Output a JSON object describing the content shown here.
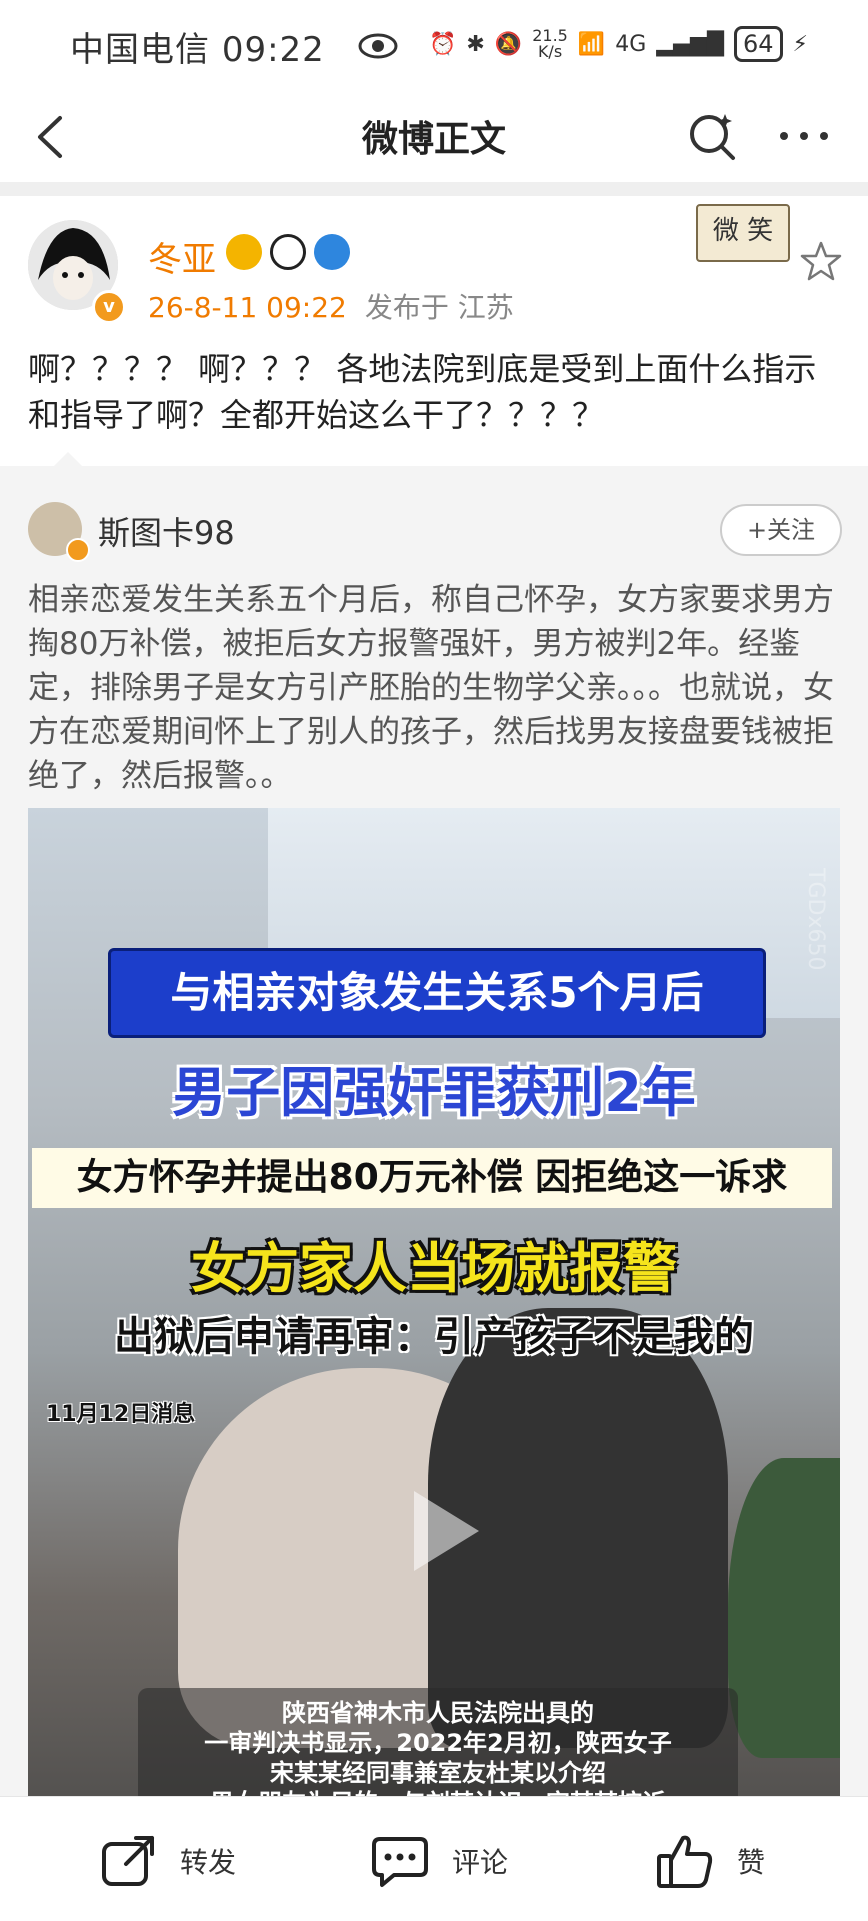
{
  "status_bar": {
    "carrier": "中国电信",
    "time": "09:22",
    "net_speed_value": "21.5",
    "net_speed_unit": "K/s",
    "network": "4G",
    "battery": "64"
  },
  "nav": {
    "title": "微博正文"
  },
  "post": {
    "username": "冬亚",
    "datetime": "26-8-11 09:22",
    "location": "发布于 江苏",
    "sticker_text": "微 笑",
    "text": "啊？？？？ 啊？？？ 各地法院到底是受到上面什么指示和指导了啊？全都开始这么干了？？？？"
  },
  "repost": {
    "username": "斯图卡98",
    "follow_label": "+关注",
    "text": "相亲恋爱发生关系五个月后，称自己怀孕，女方家要求男方掏80万补偿，被拒后女方报警强奸，男方被判2年。经鉴定，排除男子是女方引产胚胎的生物学父亲。。。也就说，女方在恋爱期间怀上了别人的孩子，然后找男友接盘要钱被拒绝了，然后报警。。",
    "video": {
      "banner1": "与相亲对象发生关系5个月后",
      "banner2": "男子因强奸罪获刑2年",
      "banner3": "女方怀孕并提出80万元补偿 因拒绝这一诉求",
      "banner4": "女方家人当场就报警",
      "banner5": "出狱后申请再审：引产孩子不是我的",
      "date": "11月12日消息",
      "caption_line1": "陕西省神木市人民法院出具的",
      "caption_line2": "一审判决书显示，2022年2月初，陕西女子",
      "caption_line3": "宋某某经同事兼室友杜某以介绍",
      "caption_line4": "男女朋友为目的，与刘某认识，宋某某控诉",
      "watermark": "TGDx650"
    }
  },
  "bottom_bar": {
    "repost_label": "转发",
    "comment_label": "评论",
    "like_label": "赞"
  }
}
